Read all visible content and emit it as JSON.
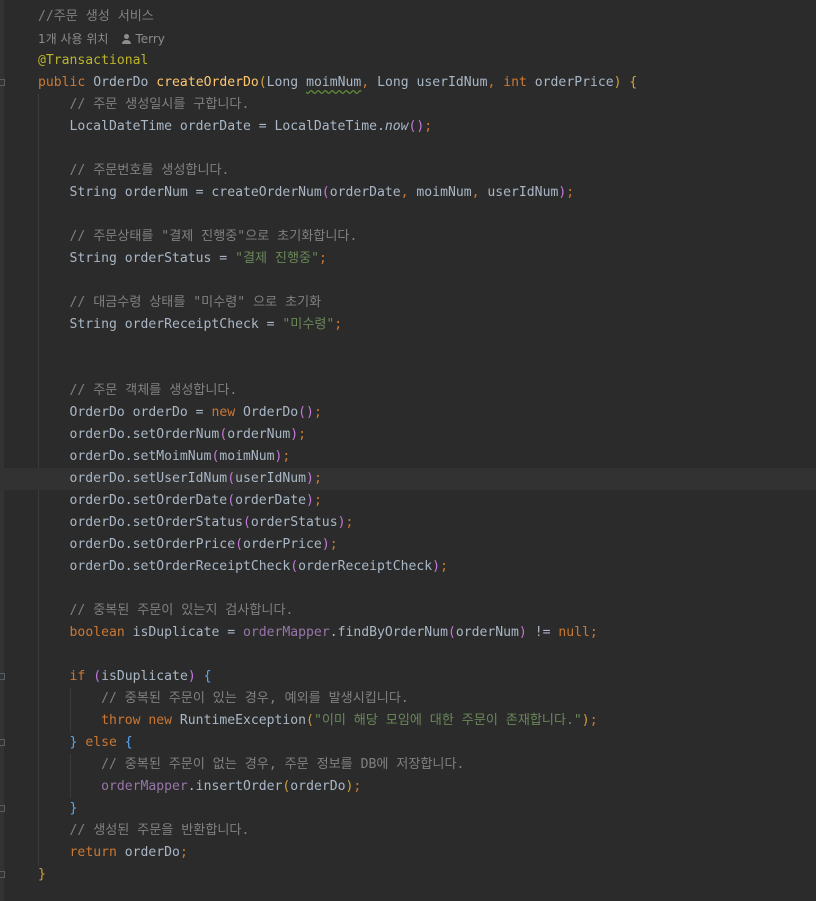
{
  "editor": {
    "header_comment": "//주문 생성 서비스",
    "usage_hint": "1개 사용 위치",
    "author": "Terry",
    "annotation": "@Transactional",
    "signature": {
      "modifier": "public",
      "return_type": "OrderDo",
      "method_name": "createOrderDo",
      "param1_type": "Long",
      "param1_name": "moimNum",
      "param2_type": "Long",
      "param2_name": "userIdNum",
      "param3_type": "int",
      "param3_name": "orderPrice"
    },
    "lines": {
      "c_orderdate": "// 주문 생성일시를 구합니다.",
      "c_ordernum": "// 주문번호를 생성합니다.",
      "c_status": "// 주문상태를 \"결제 진행중\"으로 초기화합니다.",
      "status_literal": "\"결제 진행중\"",
      "c_receipt": "// 대금수령 상태를 \"미수령\" 으로 초기화",
      "receipt_literal": "\"미수령\"",
      "c_create": "// 주문 객체를 생성합니다.",
      "c_dupcheck": "// 중복된 주문이 있는지 검사합니다.",
      "c_dup_exists": "// 중복된 주문이 있는 경우, 예외를 발생시킵니다.",
      "exception_literal": "\"이미 해당 모임에 대한 주문이 존재합니다.\"",
      "c_dup_none": "// 중복된 주문이 없는 경우, 주문 정보를 DB에 저장합니다.",
      "c_return": "// 생성된 주문을 반환합니다."
    }
  }
}
